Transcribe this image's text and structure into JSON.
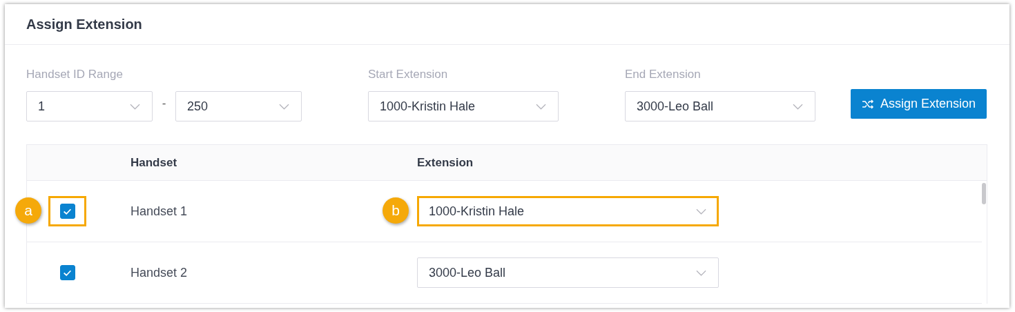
{
  "title": "Assign Extension",
  "filters": {
    "handset_id_range": {
      "label": "Handset ID Range",
      "from": "1",
      "separator": "-",
      "to": "250"
    },
    "start_extension": {
      "label": "Start Extension",
      "value": "1000-Kristin Hale"
    },
    "end_extension": {
      "label": "End Extension",
      "value": "3000-Leo Ball"
    }
  },
  "assign_button": "Assign Extension",
  "table": {
    "columns": [
      "Handset",
      "Extension"
    ],
    "rows": [
      {
        "checked": true,
        "handset": "Handset 1",
        "extension": "1000-Kristin Hale",
        "checkbox_highlighted": true,
        "checkbox_callout": "a",
        "extension_highlighted": true,
        "extension_callout": "b"
      },
      {
        "checked": true,
        "handset": "Handset 2",
        "extension": "3000-Leo Ball",
        "checkbox_highlighted": false,
        "extension_highlighted": false
      }
    ]
  }
}
